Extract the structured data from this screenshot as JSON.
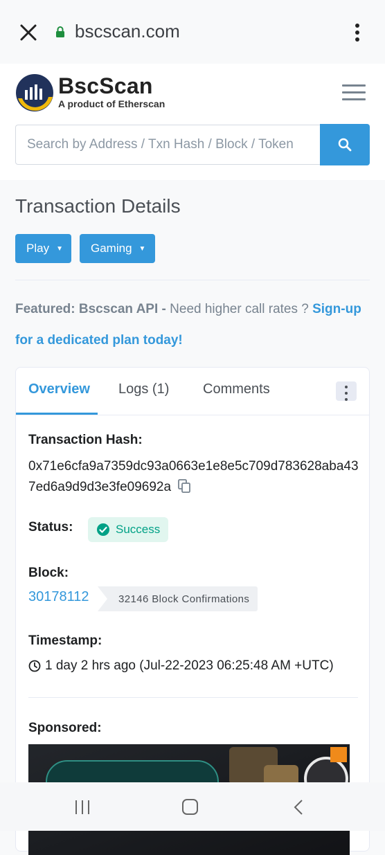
{
  "browser": {
    "url": "bscscan.com",
    "icons": {
      "close": "close-icon",
      "lock": "lock-icon",
      "menu": "more-vertical-icon"
    }
  },
  "header": {
    "brand": "BscScan",
    "tagline": "A product of Etherscan",
    "search_placeholder": "Search by Address / Txn Hash / Block / Token",
    "colors": {
      "accent": "#3498db",
      "logo_yellow": "#f0b90b"
    }
  },
  "page": {
    "title": "Transaction Details",
    "pills": [
      "Play",
      "Gaming"
    ],
    "featured": {
      "prefix": "Featured: Bscscan API -",
      "text": " Need higher call rates ? ",
      "link": "Sign-up for a dedicated plan today!"
    }
  },
  "card": {
    "tabs": [
      "Overview",
      "Logs (1)",
      "Comments"
    ],
    "active_tab": "Overview",
    "tx_hash_label": "Transaction Hash:",
    "tx_hash": "0x71e6cfa9a7359dc93a0663e1e8e5c709d783628aba437ed6a9d9d3e3fe09692a",
    "status_label": "Status:",
    "status": "Success",
    "block_label": "Block:",
    "block": "30178112",
    "confirmations": "32146 Block Confirmations",
    "timestamp_label": "Timestamp:",
    "timestamp": "1 day 2 hrs ago (Jul-22-2023 06:25:48 AM +UTC)",
    "sponsored_label": "Sponsored:",
    "status_color": "#00a186"
  }
}
